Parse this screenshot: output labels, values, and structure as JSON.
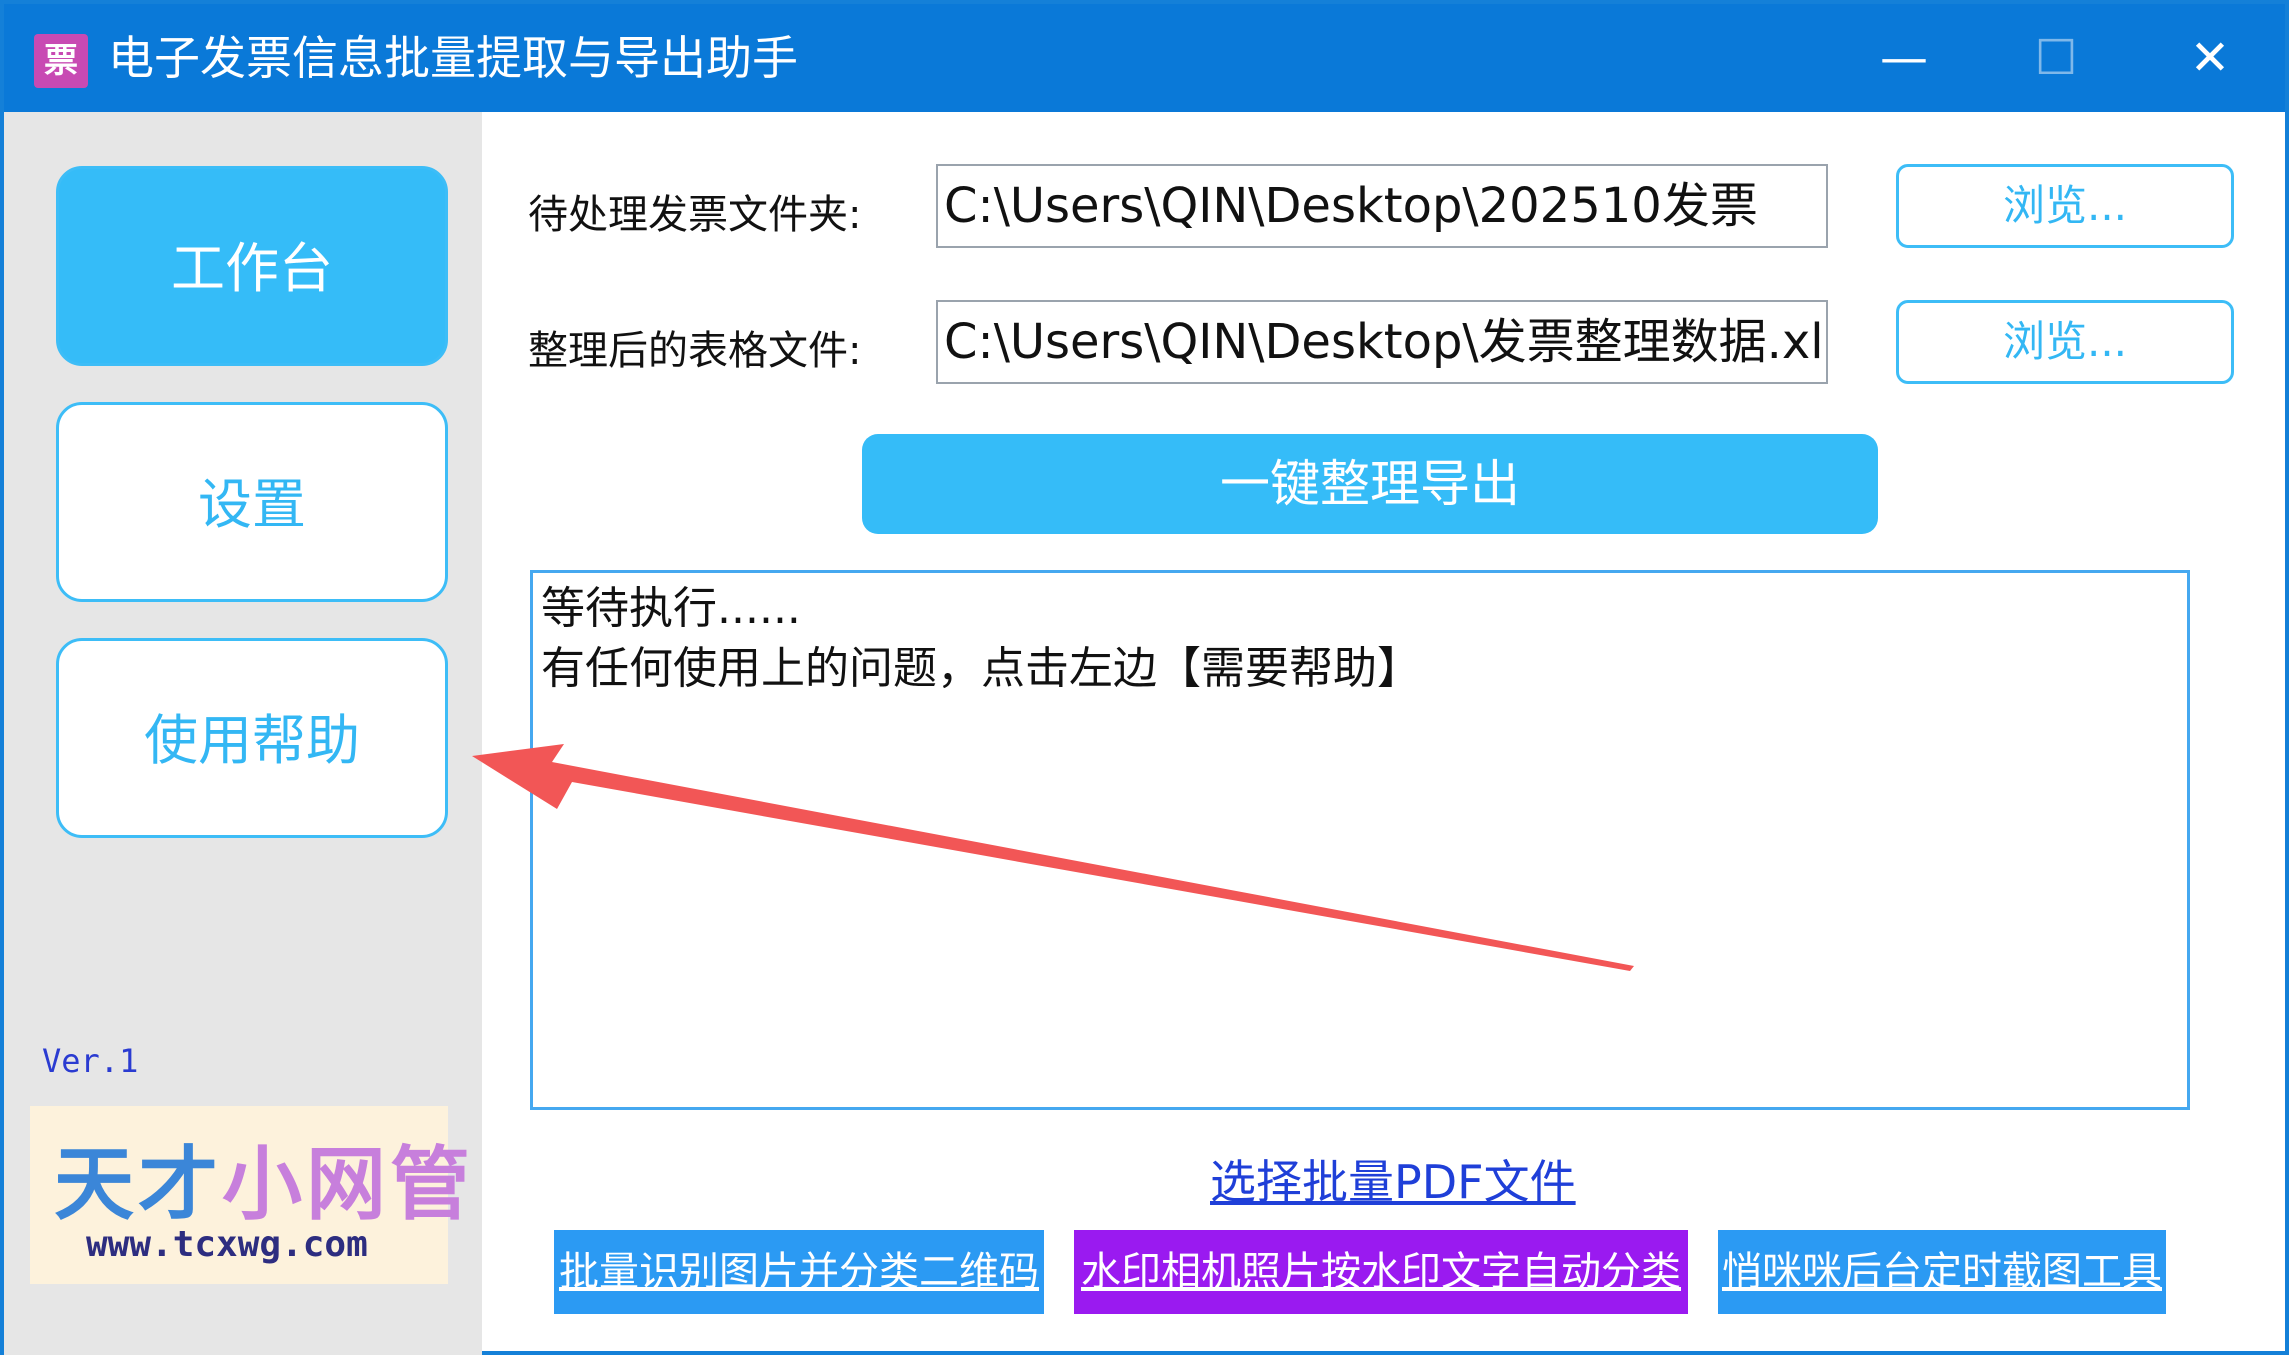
{
  "window": {
    "title": "电子发票信息批量提取与导出助手",
    "icon": "invoice-app-icon",
    "controls": {
      "minimize": "—",
      "maximize": "☐",
      "close": "✕"
    }
  },
  "sidebar": {
    "items": [
      {
        "label": "工作台",
        "active": true
      },
      {
        "label": "设置",
        "active": false
      },
      {
        "label": "使用帮助",
        "active": false
      }
    ],
    "version": "Ver.1",
    "logo": {
      "text_part1": "天才",
      "text_part2": "小网管",
      "url": "www.tcxwg.com"
    }
  },
  "form": {
    "source_label": "待处理发票文件夹:",
    "source_value": "C:\\Users\\QIN\\Desktop\\202510发票",
    "output_label": "整理后的表格文件:",
    "output_value": "C:\\Users\\QIN\\Desktop\\发票整理数据.xls",
    "browse_label": "浏览...",
    "run_button": "一键整理导出"
  },
  "log": {
    "lines": [
      "等待执行......",
      "有任何使用上的问题，点击左边【需要帮助】"
    ]
  },
  "links": {
    "select_pdf": "选择批量PDF文件",
    "tools": [
      {
        "label": "批量识别图片并分类二维码",
        "color": "#2b9af3"
      },
      {
        "label": "水印相机照片按水印文字自动分类",
        "color": "#9a1af0"
      },
      {
        "label": "悄咪咪后台定时截图工具",
        "color": "#2b9af3"
      }
    ]
  },
  "colors": {
    "titlebar": "#0a79d8",
    "accent": "#35bcf8",
    "sidebar_bg": "#e6e6e6",
    "annotation_arrow": "#f05050"
  }
}
